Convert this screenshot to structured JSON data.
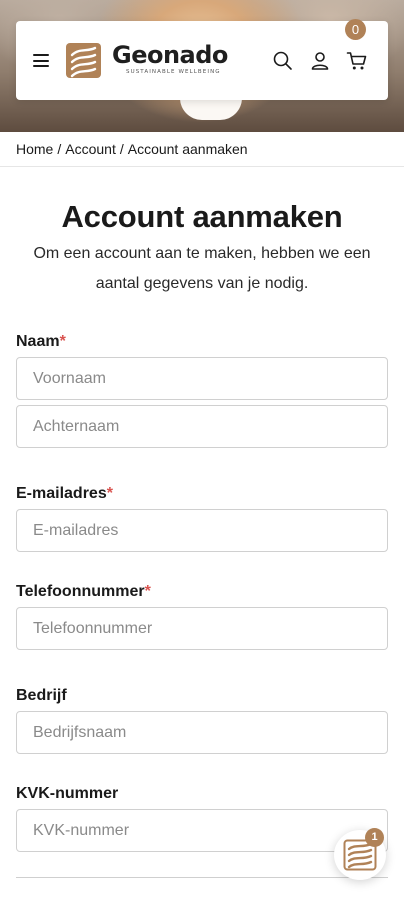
{
  "brand": {
    "name": "Geonado",
    "tagline": "SUSTAINABLE WELLBEING",
    "accent_color": "#b08257"
  },
  "header": {
    "cart_count": "0",
    "icons": [
      "menu-icon",
      "search-icon",
      "user-icon",
      "cart-icon"
    ]
  },
  "breadcrumb": {
    "home": "Home",
    "account": "Account",
    "current": "Account aanmaken",
    "separator": "/"
  },
  "page": {
    "title": "Account aanmaken",
    "intro": "Om een account aan te maken, hebben we een aantal gegevens van je nodig."
  },
  "form": {
    "required_mark": "*",
    "name_label": "Naam",
    "firstname_placeholder": "Voornaam",
    "lastname_placeholder": "Achternaam",
    "email_label": "E-mailadres",
    "email_placeholder": "E-mailadres",
    "phone_label": "Telefoonnummer",
    "phone_placeholder": "Telefoonnummer",
    "company_label": "Bedrijf",
    "company_placeholder": "Bedrijfsnaam",
    "kvk_label": "KVK-nummer",
    "kvk_placeholder": "KVK-nummer"
  },
  "widget": {
    "badge_count": "1"
  }
}
